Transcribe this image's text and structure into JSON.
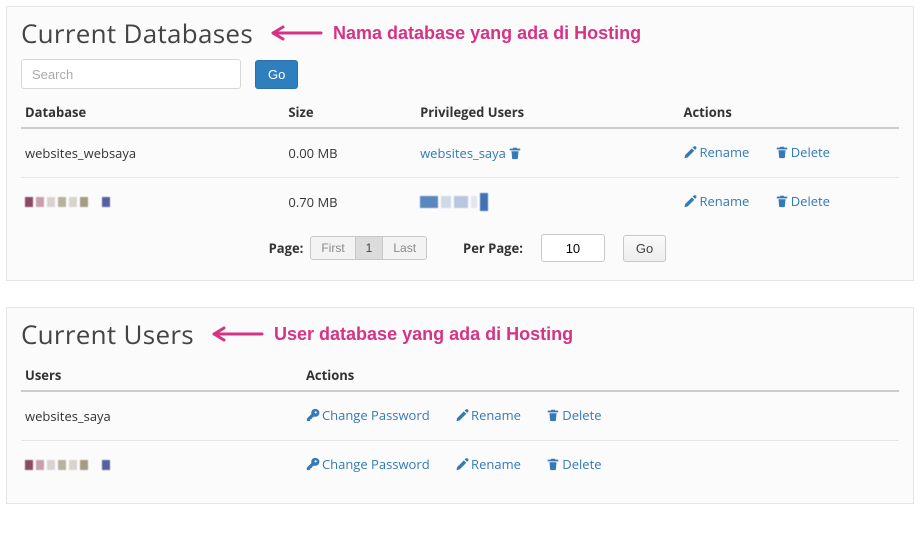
{
  "databases": {
    "heading": "Current Databases",
    "annotation": "Nama database yang ada di Hosting",
    "search_placeholder": "Search",
    "go_label": "Go",
    "columns": {
      "db": "Database",
      "size": "Size",
      "priv": "Privileged Users",
      "actions": "Actions"
    },
    "rows": [
      {
        "name": "websites_websaya",
        "size": "0.00 MB",
        "priv_user": "websites_saya",
        "rename": "Rename",
        "delete": "Delete"
      },
      {
        "name": "",
        "size": "0.70 MB",
        "priv_user": "",
        "rename": "Rename",
        "delete": "Delete"
      }
    ],
    "pager": {
      "page_label": "Page:",
      "first": "First",
      "current": "1",
      "last": "Last",
      "per_page_label": "Per Page:",
      "per_page_value": "10",
      "go": "Go"
    }
  },
  "users": {
    "heading": "Current Users",
    "annotation": "User database yang ada di Hosting",
    "columns": {
      "user": "Users",
      "actions": "Actions"
    },
    "rows": [
      {
        "name": "websites_saya",
        "change_pw": "Change Password",
        "rename": "Rename",
        "delete": "Delete"
      },
      {
        "name": "",
        "change_pw": "Change Password",
        "rename": "Rename",
        "delete": "Delete"
      }
    ]
  }
}
